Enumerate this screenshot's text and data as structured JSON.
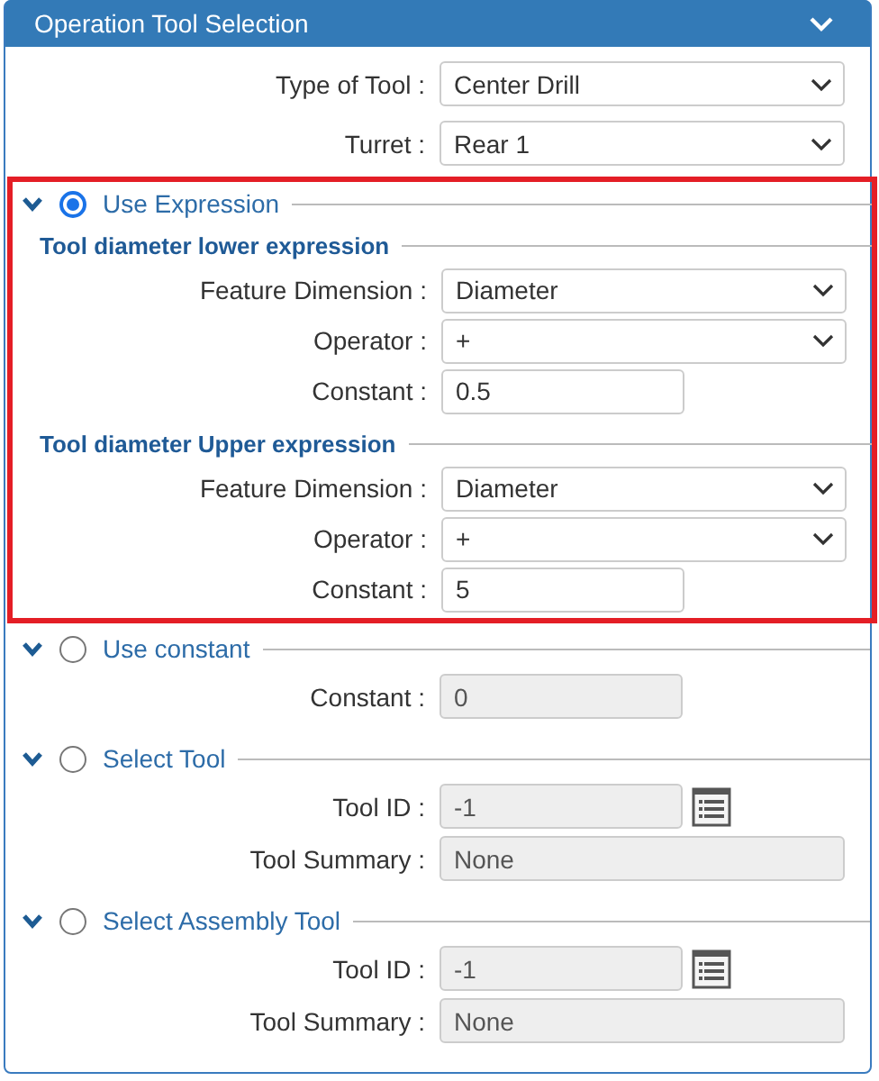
{
  "panel": {
    "title": "Operation Tool Selection",
    "expanded": true
  },
  "fields": [
    {
      "kind": "select",
      "label": "Type of Tool :",
      "value": "Center Drill",
      "disabled": false
    },
    {
      "kind": "select",
      "label": "Turret :",
      "value": "Rear 1",
      "disabled": false
    }
  ],
  "sections": [
    {
      "label": "Use Expression",
      "selected": true,
      "highlighted": true,
      "expanded": true,
      "groups": [
        {
          "title": "Tool diameter lower expression",
          "fields": [
            {
              "kind": "select",
              "label": "Feature Dimension :",
              "value": "Diameter",
              "disabled": false
            },
            {
              "kind": "select",
              "label": "Operator :",
              "value": "+",
              "disabled": false
            },
            {
              "kind": "text",
              "label": "Constant :",
              "value": "0.5",
              "disabled": false
            }
          ]
        },
        {
          "title": "Tool diameter Upper expression",
          "fields": [
            {
              "kind": "select",
              "label": "Feature Dimension :",
              "value": "Diameter",
              "disabled": false
            },
            {
              "kind": "select",
              "label": "Operator :",
              "value": "+",
              "disabled": false
            },
            {
              "kind": "text",
              "label": "Constant :",
              "value": "5",
              "disabled": false
            }
          ]
        }
      ]
    },
    {
      "label": "Use constant",
      "selected": false,
      "highlighted": false,
      "expanded": true,
      "fields": [
        {
          "kind": "text",
          "label": "Constant :",
          "value": "0",
          "disabled": true
        }
      ]
    },
    {
      "label": "Select Tool",
      "selected": false,
      "highlighted": false,
      "expanded": true,
      "fields": [
        {
          "kind": "lookup",
          "label": "Tool ID :",
          "value": "-1",
          "disabled": true
        },
        {
          "kind": "wide",
          "label": "Tool Summary :",
          "value": "None",
          "disabled": true
        }
      ]
    },
    {
      "label": "Select Assembly Tool",
      "selected": false,
      "highlighted": false,
      "expanded": true,
      "fields": [
        {
          "kind": "lookup",
          "label": "Tool ID :",
          "value": "-1",
          "disabled": true
        },
        {
          "kind": "wide",
          "label": "Tool Summary :",
          "value": "None",
          "disabled": true
        }
      ]
    }
  ]
}
